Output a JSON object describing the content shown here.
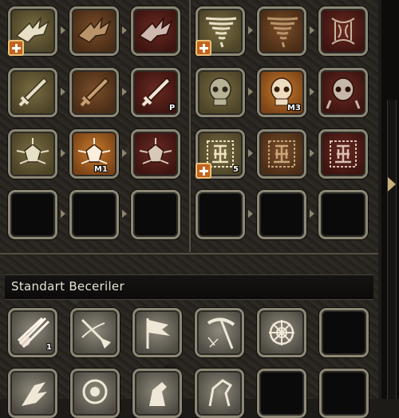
{
  "section": {
    "title": "Standart Beceriler"
  },
  "badges": {
    "sword_p": "P",
    "skull_m3": "M3",
    "emblem_m1": "M1",
    "rune_5": "5",
    "bottom_1": "1"
  },
  "colors": {
    "olive": "#7a6d42",
    "brown": "#7a4d2a",
    "red": "#6a2a22",
    "orange": "#c77c2e",
    "frame": "#8c8775",
    "plus": "#c4631e"
  },
  "icons": {
    "row1": [
      "wing-skill-icon",
      "wing-skill-icon",
      "wing-skill-icon",
      "tornado-skill-icon",
      "tornado-skill-icon",
      "tornado-skill-icon"
    ],
    "row2": [
      "sword-skill-icon",
      "sword-skill-icon",
      "sword-skill-icon",
      "skull-skill-icon",
      "skull-skill-icon",
      "skull-skill-icon"
    ],
    "row3": [
      "emblem-skill-icon",
      "emblem-skill-icon",
      "emblem-skill-icon",
      "rune-skill-icon",
      "rune-skill-icon",
      "rune-skill-icon"
    ],
    "standard": [
      "flame-slash-icon",
      "broom-icon",
      "flag-icon",
      "pickaxe-icon",
      "knot-icon"
    ]
  }
}
